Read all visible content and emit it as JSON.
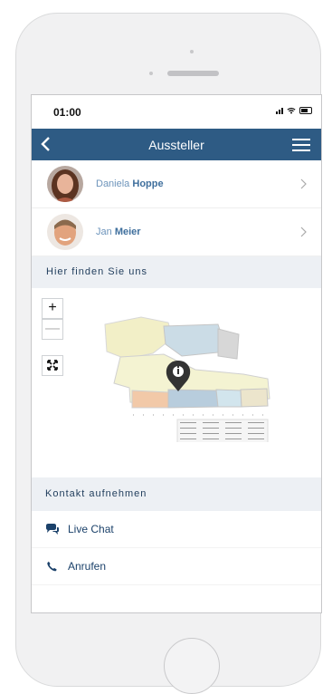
{
  "status_bar": {
    "time": "01:00"
  },
  "nav": {
    "title": "Aussteller",
    "back_icon": "back-icon",
    "menu_icon": "menu-icon"
  },
  "exhibitors": [
    {
      "first": "Daniela",
      "last": "Hoppe"
    },
    {
      "first": "Jan",
      "last": "Meier"
    }
  ],
  "location": {
    "title": "Hier finden Sie uns",
    "zoom_in": "+",
    "zoom_out": "—"
  },
  "contact": {
    "title": "Kontakt aufnehmen",
    "items": [
      {
        "label": "Live Chat",
        "icon": "chat-icon"
      },
      {
        "label": "Anrufen",
        "icon": "phone-icon"
      }
    ]
  },
  "colors": {
    "primary": "#2e5b84",
    "section_bg": "#edf0f4",
    "name_first": "#6d94bb",
    "name_last": "#3f6f9d"
  }
}
